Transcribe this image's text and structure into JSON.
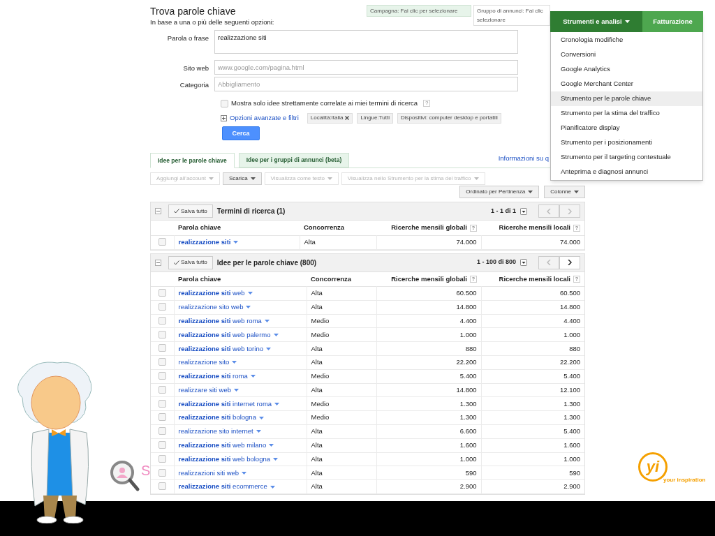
{
  "page": {
    "title": "Trova parole chiave",
    "subtitle": "In base a una o più delle seguenti opzioni:"
  },
  "selectors": [
    {
      "kind": "campaign",
      "lines": [
        "Campagna: Fai clic per selezionare"
      ]
    },
    {
      "kind": "group",
      "lines": [
        "Gruppo di annunci: Fai clic",
        "selezionare"
      ]
    }
  ],
  "form": {
    "fields": [
      {
        "label": "Parola o frase",
        "value": "realizzazione siti",
        "kind": "textarea"
      },
      {
        "label": "Sito web",
        "placeholder": "www.google.com/pagina.html",
        "kind": "input"
      },
      {
        "label": "Categoria",
        "placeholder": "Abbigliamento",
        "kind": "input"
      }
    ],
    "only_related": {
      "label": "Mostra solo idee strettamente correlate ai miei termini di ricerca",
      "checked": false,
      "help": "?"
    },
    "advanced_link": "Opzioni avanzate e filtri",
    "filters": [
      {
        "text": "Località:Italia",
        "removable": true
      },
      {
        "text": "Lingue:Tutti",
        "removable": false
      },
      {
        "text": "Dispositivi: computer desktop e portatili",
        "removable": false
      }
    ],
    "search_button": "Cerca"
  },
  "tabs": [
    {
      "label": "Idee per le parole chiave",
      "selected": true
    },
    {
      "label": "Idee per i gruppi di annunci (beta)",
      "selected": false
    }
  ],
  "info_link": "Informazioni su q",
  "toolbar": [
    {
      "label": "Aggiungi all'account",
      "disabled": true
    },
    {
      "label": "Scarica",
      "disabled": false
    },
    {
      "label": "Visualizza come testo",
      "disabled": true
    },
    {
      "label": "Visualizza nello Strumento per la stima del traffico",
      "disabled": true
    }
  ],
  "sort_button": "Ordinato per Pertinenza",
  "columns_button": "Colonne",
  "sections": [
    {
      "save_button": "Salva tutto",
      "title": "Termini di ricerca (1)",
      "pagination": "1 - 1 di 1",
      "prev_disabled": true,
      "next_disabled": true,
      "columns": [
        {
          "label": "Parola chiave"
        },
        {
          "label": "Concorrenza"
        },
        {
          "label": "Ricerche mensili globali",
          "help": "?"
        },
        {
          "label": "Ricerche mensili locali",
          "help": "?"
        }
      ],
      "rows": [
        {
          "checked": false,
          "keyword": "**realizzazione siti**",
          "competition": "Alta",
          "global": "74.000",
          "local": "74.000"
        }
      ]
    },
    {
      "save_button": "Salva tutto",
      "title": "Idee per le parole chiave (800)",
      "pagination": "1 - 100 di 800",
      "prev_disabled": true,
      "next_disabled": false,
      "columns": [
        {
          "label": "Parola chiave"
        },
        {
          "label": "Concorrenza"
        },
        {
          "label": "Ricerche mensili globali",
          "help": "?"
        },
        {
          "label": "Ricerche mensili locali",
          "help": "?"
        }
      ],
      "rows": [
        {
          "checked": false,
          "keyword": "**realizzazione siti** web",
          "competition": "Alta",
          "global": "60.500",
          "local": "60.500"
        },
        {
          "checked": false,
          "keyword": "realizzazione sito web",
          "competition": "Alta",
          "global": "14.800",
          "local": "14.800"
        },
        {
          "checked": false,
          "keyword": "**realizzazione siti** web roma",
          "competition": "Medio",
          "global": "4.400",
          "local": "4.400"
        },
        {
          "checked": false,
          "keyword": "**realizzazione siti** web palermo",
          "competition": "Medio",
          "global": "1.000",
          "local": "1.000"
        },
        {
          "checked": false,
          "keyword": "**realizzazione siti** web torino",
          "competition": "Alta",
          "global": "880",
          "local": "880"
        },
        {
          "checked": false,
          "keyword": "realizzazione sito",
          "competition": "Alta",
          "global": "22.200",
          "local": "22.200"
        },
        {
          "checked": false,
          "keyword": "**realizzazione siti** roma",
          "competition": "Medio",
          "global": "5.400",
          "local": "5.400"
        },
        {
          "checked": false,
          "keyword": "realizzare siti web",
          "competition": "Alta",
          "global": "14.800",
          "local": "12.100"
        },
        {
          "checked": false,
          "keyword": "**realizzazione siti** internet roma",
          "competition": "Medio",
          "global": "1.300",
          "local": "1.300"
        },
        {
          "checked": false,
          "keyword": "**realizzazione siti** bologna",
          "competition": "Medio",
          "global": "1.300",
          "local": "1.300"
        },
        {
          "checked": false,
          "keyword": "realizzazione sito internet",
          "competition": "Alta",
          "global": "6.600",
          "local": "5.400"
        },
        {
          "checked": false,
          "keyword": "**realizzazione siti** web milano",
          "competition": "Alta",
          "global": "1.600",
          "local": "1.600"
        },
        {
          "checked": false,
          "keyword": "**realizzazione siti** web bologna",
          "competition": "Alta",
          "global": "1.000",
          "local": "1.000"
        },
        {
          "checked": false,
          "keyword": "realizzazioni siti web",
          "competition": "Alta",
          "global": "590",
          "local": "590"
        },
        {
          "checked": false,
          "keyword": "**realizzazione siti** ecommerce",
          "competition": "Alta",
          "global": "2.900",
          "local": "2.900"
        }
      ]
    }
  ],
  "top_menu": {
    "tabs": [
      {
        "label": "Strumenti e analisi",
        "selected": true
      },
      {
        "label": "Fatturazione",
        "selected": false
      }
    ],
    "items": [
      {
        "label": "Cronologia modifiche",
        "selected": false
      },
      {
        "label": "Conversioni",
        "selected": false
      },
      {
        "label": "Google Analytics",
        "selected": false
      },
      {
        "label": "Google Merchant Center",
        "selected": false
      },
      {
        "label": "Strumento per le parole chiave",
        "selected": true
      },
      {
        "label": "Strumento per la stima del traffico",
        "selected": false
      },
      {
        "label": "Pianificatore display",
        "selected": false
      },
      {
        "label": "Strumento per i posizionamenti",
        "selected": false
      },
      {
        "label": "Strumento per il targeting contestuale",
        "selected": false
      },
      {
        "label": "Anteprima e diagnosi annunci",
        "selected": false
      }
    ]
  },
  "slide": {
    "side_letter": "S",
    "logo": {
      "mark": "yi",
      "tagline": "your inspiration"
    }
  }
}
